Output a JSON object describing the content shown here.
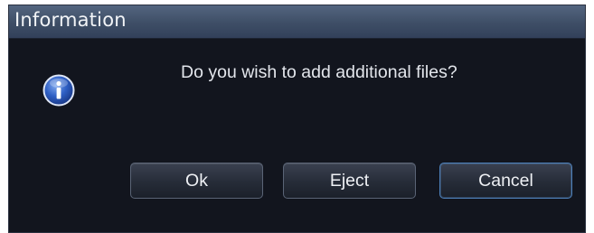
{
  "dialog": {
    "title": "Information",
    "message": "Do you wish to add additional files?",
    "icon": "info-icon",
    "buttons": {
      "ok": "Ok",
      "eject": "Eject",
      "cancel": "Cancel"
    }
  },
  "colors": {
    "background": "#12151e",
    "titlebar": "#3e4e66",
    "text": "#e3e6ec",
    "focus_border": "#4d7fb8"
  }
}
